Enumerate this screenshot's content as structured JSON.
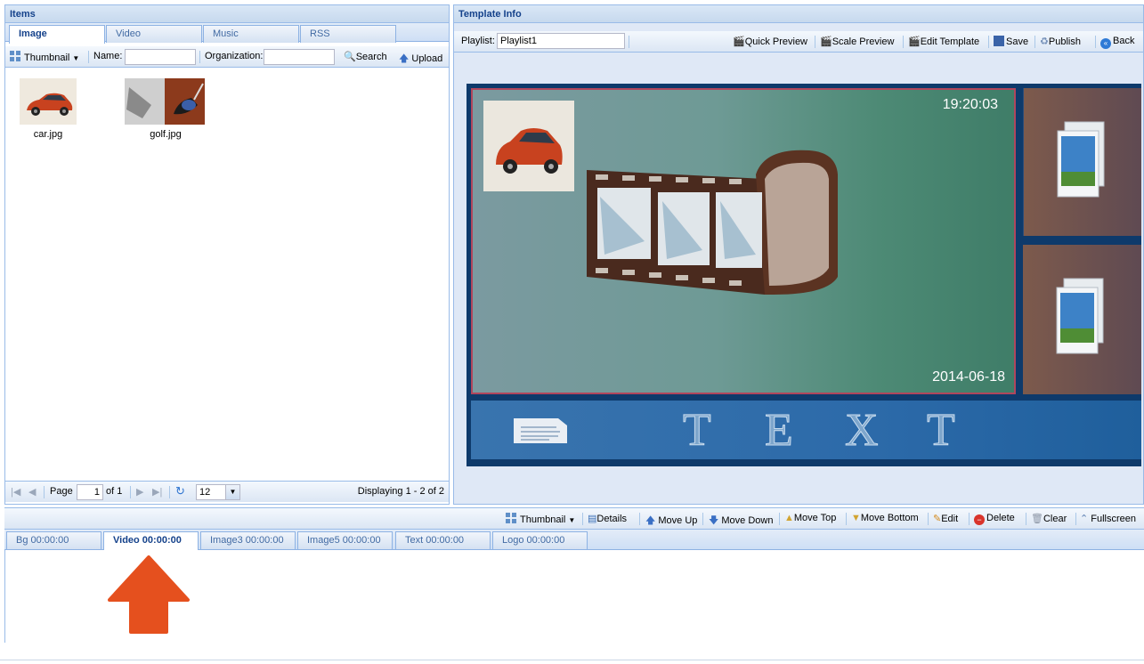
{
  "items_panel": {
    "title": "Items",
    "tabs": [
      "Image",
      "Video",
      "Music",
      "RSS"
    ],
    "toolbar": {
      "view_label": "Thumbnail",
      "name_label": "Name:",
      "name_value": "",
      "org_label": "Organization:",
      "org_value": "",
      "search_label": "Search",
      "upload_label": "Upload"
    },
    "thumbnails": [
      {
        "name": "car.jpg"
      },
      {
        "name": "golf.jpg"
      }
    ],
    "pager": {
      "page_label": "Page",
      "page_value": "1",
      "of_label": "of 1",
      "page_size": "12",
      "displaying": "Displaying 1 - 2 of 2"
    }
  },
  "template_panel": {
    "title": "Template Info",
    "playlist_label": "Playlist:",
    "playlist_value": "Playlist1",
    "actions": [
      "Quick Preview",
      "Scale Preview",
      "Edit Template",
      "Save",
      "Publish",
      "Back"
    ],
    "preview": {
      "time": "19:20:03",
      "date": "2014-06-18",
      "text_letters": [
        "T",
        "E",
        "X",
        "T"
      ]
    }
  },
  "bottom_toolbar": {
    "view_label": "Thumbnail",
    "actions": [
      "Details",
      "Move Up",
      "Move Down",
      "Move Top",
      "Move Bottom",
      "Edit",
      "Delete",
      "Clear",
      "Fullscreen"
    ]
  },
  "timeline_tabs": [
    {
      "label": "Bg  00:00:00"
    },
    {
      "label": "Video 00:00:00"
    },
    {
      "label": "Image3 00:00:00"
    },
    {
      "label": "Image5 00:00:00"
    },
    {
      "label": "Text 00:00:00"
    },
    {
      "label": "Logo 00:00:00"
    }
  ],
  "colors": {
    "header_text": "#15428b",
    "arrow": "#e5501e",
    "stage_bg": "#0e3a6b"
  }
}
